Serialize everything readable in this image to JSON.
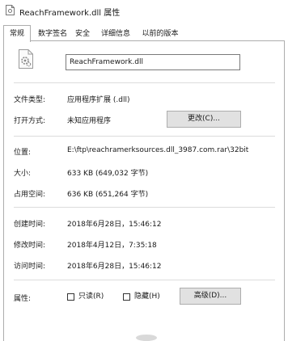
{
  "window": {
    "title": "ReachFramework.dll 属性"
  },
  "tabs": [
    "常规",
    "数字签名",
    "安全",
    "详细信息",
    "以前的版本"
  ],
  "file": {
    "name": "ReachFramework.dll"
  },
  "rows": {
    "type_label": "文件类型:",
    "type_value": "应用程序扩展 (.dll)",
    "opens_label": "打开方式:",
    "opens_value": "未知应用程序",
    "change_button": "更改(C)...",
    "location_label": "位置:",
    "location_value": "E:\\ftp\\reachramerksources.dll_3987.com.rar\\32bit",
    "size_label": "大小:",
    "size_value": "633 KB (649,032 字节)",
    "disk_label": "占用空间:",
    "disk_value": "636 KB (651,264 字节)",
    "created_label": "创建时间:",
    "created_value": "2018年6月28日，15:46:12",
    "modified_label": "修改时间:",
    "modified_value": "2018年4月12日，7:35:18",
    "accessed_label": "访问时间:",
    "accessed_value": "2018年6月28日，15:46:12",
    "attributes_label": "属性:",
    "readonly_label": "只读(R)",
    "hidden_label": "隐藏(H)",
    "advanced_button": "高级(D)..."
  }
}
